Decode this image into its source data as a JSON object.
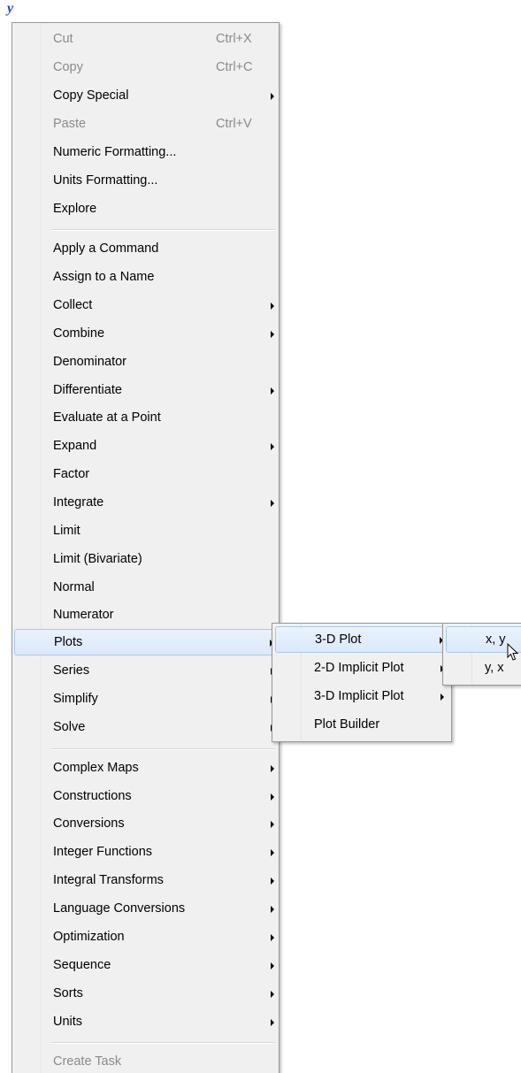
{
  "expression": {
    "variable": "y"
  },
  "context_menu": {
    "group1": [
      {
        "label": "Cut",
        "shortcut": "Ctrl+X",
        "disabled": true
      },
      {
        "label": "Copy",
        "shortcut": "Ctrl+C",
        "disabled": true
      },
      {
        "label": "Copy Special",
        "submenu": true
      },
      {
        "label": "Paste",
        "shortcut": "Ctrl+V",
        "disabled": true
      },
      {
        "label": "Numeric Formatting..."
      },
      {
        "label": "Units Formatting..."
      },
      {
        "label": "Explore"
      }
    ],
    "group2": [
      {
        "label": "Apply a Command"
      },
      {
        "label": "Assign to a Name"
      },
      {
        "label": "Collect",
        "submenu": true
      },
      {
        "label": "Combine",
        "submenu": true
      },
      {
        "label": "Denominator"
      },
      {
        "label": "Differentiate",
        "submenu": true
      },
      {
        "label": "Evaluate at a Point"
      },
      {
        "label": "Expand",
        "submenu": true
      },
      {
        "label": "Factor"
      },
      {
        "label": "Integrate",
        "submenu": true
      },
      {
        "label": "Limit"
      },
      {
        "label": "Limit (Bivariate)"
      },
      {
        "label": "Normal"
      },
      {
        "label": "Numerator"
      },
      {
        "label": "Plots",
        "submenu": true,
        "highlighted": true
      },
      {
        "label": "Series",
        "submenu": true
      },
      {
        "label": "Simplify",
        "submenu": true
      },
      {
        "label": "Solve",
        "submenu": true
      }
    ],
    "group3": [
      {
        "label": "Complex Maps",
        "submenu": true
      },
      {
        "label": "Constructions",
        "submenu": true
      },
      {
        "label": "Conversions",
        "submenu": true
      },
      {
        "label": "Integer Functions",
        "submenu": true
      },
      {
        "label": "Integral Transforms",
        "submenu": true
      },
      {
        "label": "Language Conversions",
        "submenu": true
      },
      {
        "label": "Optimization",
        "submenu": true
      },
      {
        "label": "Sequence",
        "submenu": true
      },
      {
        "label": "Sorts",
        "submenu": true
      },
      {
        "label": "Units",
        "submenu": true
      }
    ],
    "group4": [
      {
        "label": "Create Task",
        "disabled": true
      }
    ]
  },
  "plots_submenu": [
    {
      "label": "3-D Plot",
      "submenu": true,
      "highlighted": true
    },
    {
      "label": "2-D Implicit Plot",
      "submenu": true
    },
    {
      "label": "3-D Implicit Plot",
      "submenu": true
    },
    {
      "label": "Plot Builder"
    }
  ],
  "plot3d_submenu": [
    {
      "label": "x, y",
      "highlighted": true
    },
    {
      "label": "y, x"
    }
  ],
  "colors": {
    "highlight": "#dbe9fb",
    "highlight_border": "#a8c8ee",
    "disabled_text": "#8a8a8a",
    "variable": "#1f3fd8"
  }
}
